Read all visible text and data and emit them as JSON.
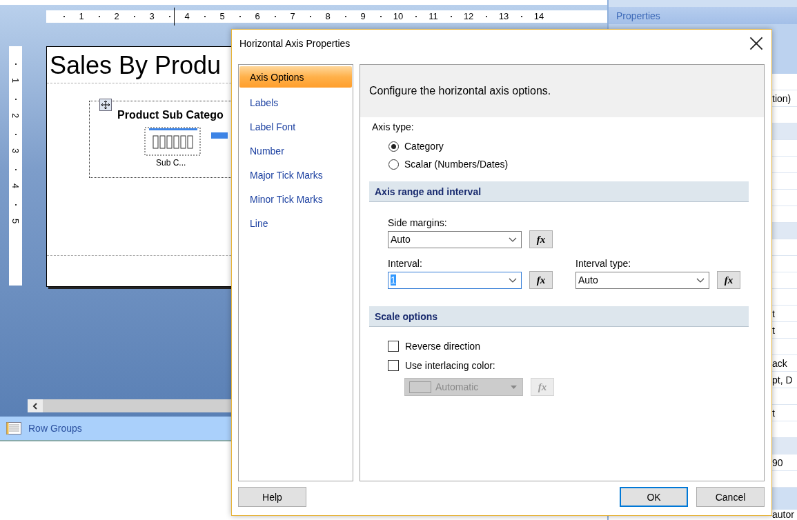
{
  "designer": {
    "ruler_numbers": [
      "1",
      "2",
      "3",
      "4",
      "5",
      "6",
      "7",
      "8",
      "9",
      "10",
      "11",
      "12",
      "13",
      "14"
    ],
    "vertical_ruler_numbers": [
      "1",
      "2",
      "3",
      "4",
      "5"
    ],
    "report": {
      "title": "Sales By Produ",
      "chart_title": "Product Sub Catego",
      "axis_caption": "Sub C..."
    },
    "row_groups": "Row Groups"
  },
  "properties": {
    "title": "Properties",
    "rows": [
      {
        "kind": "row"
      },
      {
        "kind": "row",
        "text": "tion)"
      },
      {
        "kind": "row"
      },
      {
        "kind": "category"
      },
      {
        "kind": "row"
      },
      {
        "kind": "row"
      },
      {
        "kind": "row"
      },
      {
        "kind": "row"
      },
      {
        "kind": "row"
      },
      {
        "kind": "category"
      },
      {
        "kind": "row"
      },
      {
        "kind": "row"
      },
      {
        "kind": "row"
      },
      {
        "kind": "row"
      },
      {
        "kind": "row",
        "text": "t"
      },
      {
        "kind": "row",
        "text": "t"
      },
      {
        "kind": "row"
      },
      {
        "kind": "row",
        "text": "ack"
      },
      {
        "kind": "row",
        "text": "pt, D"
      },
      {
        "kind": "row"
      },
      {
        "kind": "row",
        "text": "t"
      },
      {
        "kind": "row"
      },
      {
        "kind": "category"
      },
      {
        "kind": "row",
        "text": "90"
      },
      {
        "kind": "row"
      }
    ],
    "description": "autor"
  },
  "dialog": {
    "title": "Horizontal Axis Properties",
    "nav": [
      {
        "label": "Axis Options",
        "selected": true
      },
      {
        "label": "Labels",
        "selected": false
      },
      {
        "label": "Label Font",
        "selected": false
      },
      {
        "label": "Number",
        "selected": false
      },
      {
        "label": "Major Tick Marks",
        "selected": false
      },
      {
        "label": "Minor Tick Marks",
        "selected": false
      },
      {
        "label": "Line",
        "selected": false
      }
    ],
    "header": "Configure the horizontal axis options.",
    "axis_type": {
      "label": "Axis type:",
      "options": [
        {
          "label": "Category",
          "selected": true
        },
        {
          "label": "Scalar (Numbers/Dates)",
          "selected": false
        }
      ]
    },
    "range_section": {
      "title": "Axis range and interval",
      "side_margins": {
        "label": "Side margins:",
        "value": "Auto",
        "focused": false,
        "fx": "fx"
      },
      "interval": {
        "label": "Interval:",
        "value": "1",
        "focused": true,
        "fx": "fx"
      },
      "interval_type": {
        "label": "Interval type:",
        "value": "Auto",
        "focused": false,
        "fx": "fx"
      }
    },
    "scale_section": {
      "title": "Scale options",
      "checkboxes": [
        {
          "label": "Reverse direction",
          "checked": false
        },
        {
          "label": "Use interlacing color:",
          "checked": false
        }
      ],
      "color_picker": {
        "value": "Automatic",
        "disabled": true,
        "fx": "fx"
      }
    },
    "help": "Help",
    "buttons": [
      {
        "label": "OK",
        "default": true
      },
      {
        "label": "Cancel",
        "default": false
      }
    ]
  }
}
